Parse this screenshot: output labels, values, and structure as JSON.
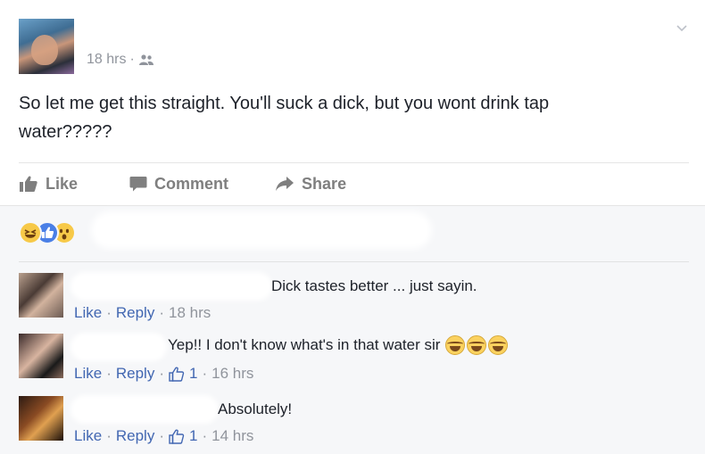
{
  "post": {
    "time": "18 hrs",
    "separator": "·",
    "text": "So let me get this straight. You'll suck a dick, but you wont drink tap water?????"
  },
  "actions": {
    "like": "Like",
    "comment": "Comment",
    "share": "Share"
  },
  "reactions": [
    "haha",
    "like",
    "wow"
  ],
  "comments": [
    {
      "text": "Dick tastes better ... just sayin.",
      "like": "Like",
      "reply": "Reply",
      "likes": "",
      "time": "18 hrs"
    },
    {
      "text": "Yep!! I don't know what's in that water sir",
      "like": "Like",
      "reply": "Reply",
      "likes": "1",
      "time": "16 hrs"
    },
    {
      "text": "Absolutely!",
      "like": "Like",
      "reply": "Reply",
      "likes": "1",
      "time": "14 hrs"
    }
  ],
  "colors": {
    "link": "#4267b2",
    "meta": "#90949c",
    "action": "#7f7f7f",
    "comments_bg": "#f6f7f9"
  }
}
